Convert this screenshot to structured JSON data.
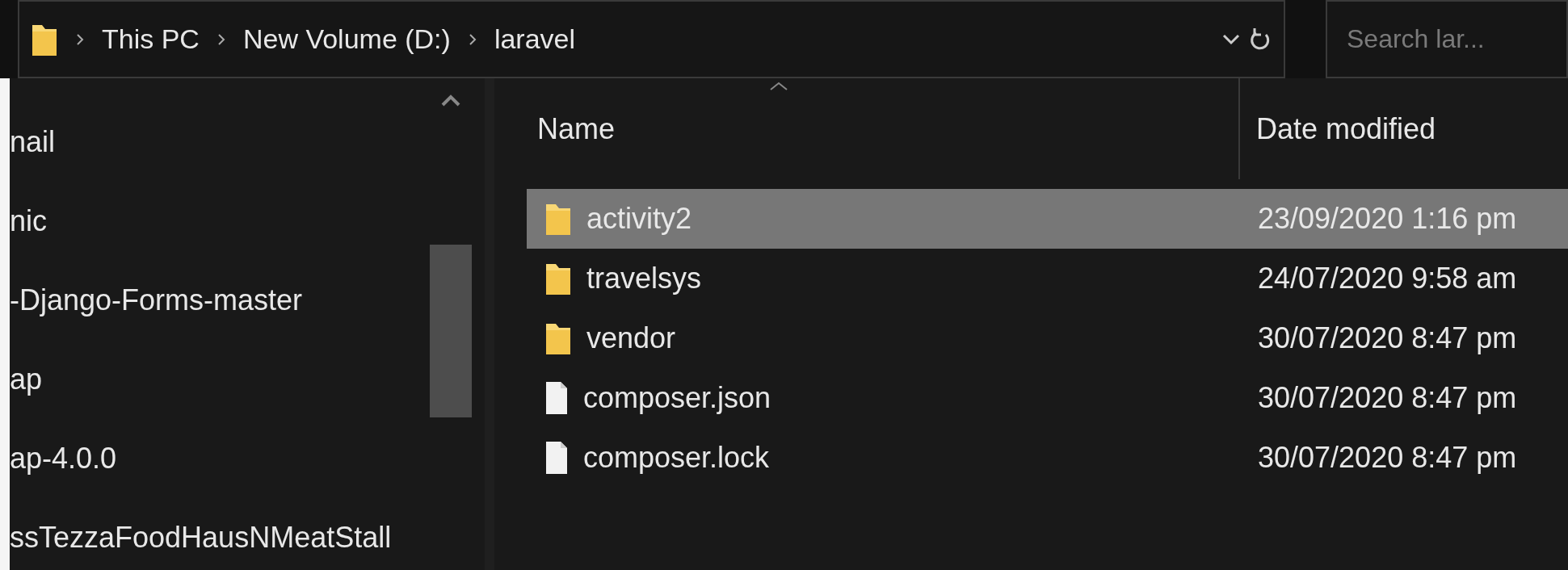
{
  "address_bar": {
    "path": [
      {
        "label": "This PC"
      },
      {
        "label": "New Volume (D:)"
      },
      {
        "label": "laravel"
      }
    ]
  },
  "search": {
    "placeholder": "Search lar..."
  },
  "navigation_pane": {
    "items": [
      {
        "label": "nail"
      },
      {
        "label": "nic"
      },
      {
        "label": "-Django-Forms-master"
      },
      {
        "label": "ap"
      },
      {
        "label": "ap-4.0.0"
      },
      {
        "label": "ssTezzaFoodHausNMeatStall"
      }
    ]
  },
  "file_list": {
    "columns": [
      {
        "label": "Name"
      },
      {
        "label": "Date modified"
      }
    ],
    "rows": [
      {
        "kind": "folder",
        "name": "activity2",
        "date": "23/09/2020 1:16 pm",
        "selected": true
      },
      {
        "kind": "folder",
        "name": "travelsys",
        "date": "24/07/2020 9:58 am",
        "selected": false
      },
      {
        "kind": "folder",
        "name": "vendor",
        "date": "30/07/2020 8:47 pm",
        "selected": false
      },
      {
        "kind": "file",
        "name": "composer.json",
        "date": "30/07/2020 8:47 pm",
        "selected": false
      },
      {
        "kind": "file",
        "name": "composer.lock",
        "date": "30/07/2020 8:47 pm",
        "selected": false
      }
    ]
  }
}
